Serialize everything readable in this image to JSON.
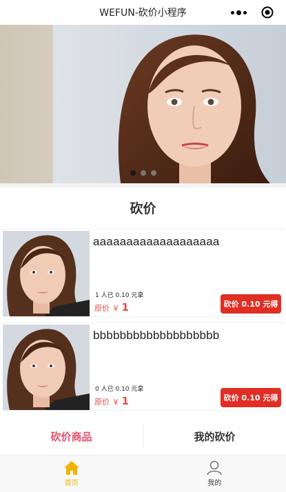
{
  "navbar": {
    "title": "WEFUN-砍价小程序"
  },
  "banner": {
    "slides": 3,
    "active": 0
  },
  "section": {
    "title": "砍价"
  },
  "products": [
    {
      "name": "aaaaaaaaaaaaaaaaaaa",
      "bargain_text": "1 人已 0.10 元拿",
      "price_label": "原价 ￥",
      "price": "1",
      "button": "砍价 0.10 元得"
    },
    {
      "name": "bbbbbbbbbbbbbbbbbbb",
      "bargain_text": "0 人已 0.10 元拿",
      "price_label": "原价 ￥",
      "price": "1",
      "button": "砍价 0.10 元得"
    }
  ],
  "tabs": [
    {
      "label": "砍价商品",
      "active": true
    },
    {
      "label": "我的砍价",
      "active": false
    }
  ],
  "tabbar": [
    {
      "label": "首页",
      "icon": "home-icon",
      "active": true
    },
    {
      "label": "我的",
      "icon": "user-icon",
      "active": false
    }
  ],
  "colors": {
    "accent": "#e02e24",
    "price": "#e54d42",
    "tab_active": "#e54d6a",
    "tabbar_active": "#f0b400"
  }
}
